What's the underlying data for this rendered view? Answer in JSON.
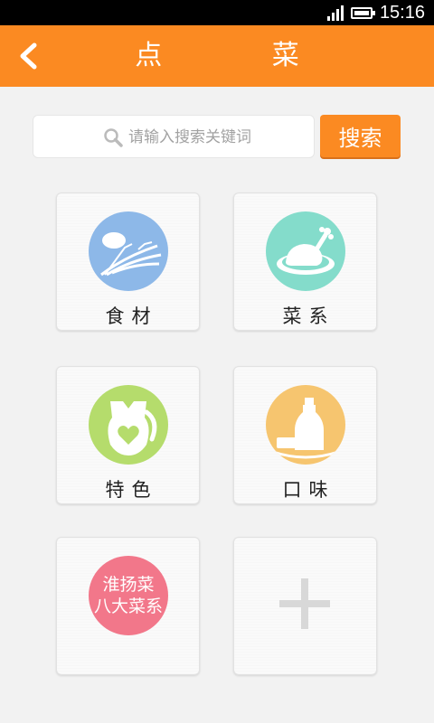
{
  "status_bar": {
    "time": "15:16"
  },
  "header": {
    "title": "点 菜"
  },
  "search": {
    "placeholder": "请输入搜索关键词",
    "button_label": "搜索"
  },
  "categories": [
    {
      "label": "食材",
      "color": "#8db8e8",
      "icon": "ingredients-icon"
    },
    {
      "label": "菜系",
      "color": "#84dccb",
      "icon": "roast-chicken-icon"
    },
    {
      "label": "特色",
      "color": "#b5dc6c",
      "icon": "apron-heart-icon"
    },
    {
      "label": "口味",
      "color": "#f6c56f",
      "icon": "sauce-bottle-icon"
    }
  ],
  "promo_tile": {
    "line1": "淮扬菜",
    "line2": "八大菜系",
    "color": "#f2778a"
  },
  "add_tile": {
    "icon": "plus-icon"
  }
}
